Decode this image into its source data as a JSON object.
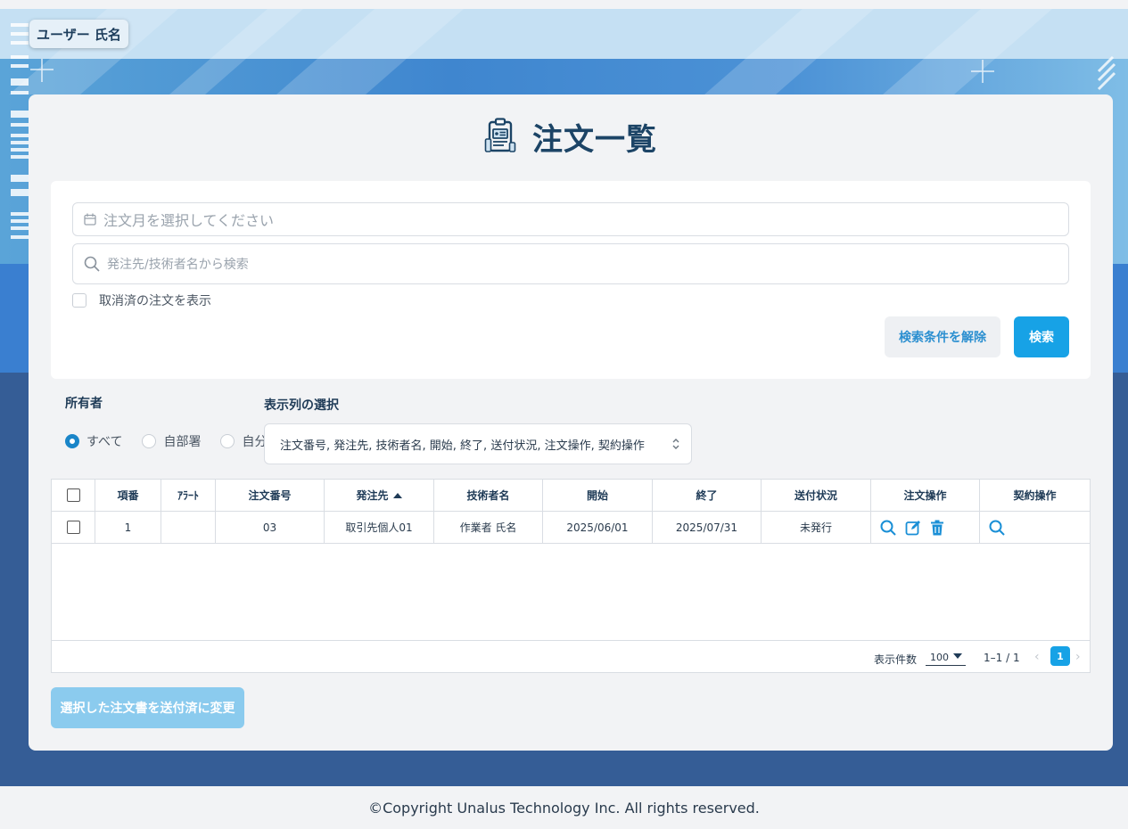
{
  "user": {
    "name": "ユーザー 氏名"
  },
  "page": {
    "title": "注文一覧"
  },
  "search": {
    "month_placeholder": "注文月を選択してください",
    "keyword_placeholder": "発注先/技術者名から検索",
    "show_cancelled_label": "取消済の注文を表示",
    "clear_label": "検索条件を解除",
    "search_label": "検索"
  },
  "owner": {
    "label": "所有者",
    "options": [
      "すべて",
      "自部署",
      "自分"
    ],
    "selected": "すべて"
  },
  "columns": {
    "label": "表示列の選択",
    "value": "注文番号, 発注先, 技術者名, 開始, 終了, 送付状況, 注文操作, 契約操作"
  },
  "table": {
    "headers": [
      "項番",
      "ｱﾗｰﾄ",
      "注文番号",
      "発注先",
      "技術者名",
      "開始",
      "終了",
      "送付状況",
      "注文操作",
      "契約操作"
    ],
    "sorted_column": "発注先",
    "rows": [
      {
        "index": "1",
        "alert": "",
        "order_no": "03",
        "supplier": "取引先個人01",
        "engineer": "作業者 氏名",
        "start": "2025/06/01",
        "end": "2025/07/31",
        "status": "未発行",
        "order_actions": [
          "search-icon",
          "edit-icon",
          "trash-icon"
        ],
        "contract_actions": [
          "search-icon"
        ]
      }
    ]
  },
  "pagination": {
    "per_page_label": "表示件数",
    "per_page": "100",
    "range": "1–1 / 1",
    "current_page": "1"
  },
  "bulk_action": {
    "label": "選択した注文書を送付済に変更"
  },
  "footer": {
    "copyright": "©Copyright Unalus Technology Inc. All rights reserved."
  },
  "colors": {
    "accent": "#17a2e6",
    "title": "#1c4466",
    "bg_dark": "#355d96"
  }
}
